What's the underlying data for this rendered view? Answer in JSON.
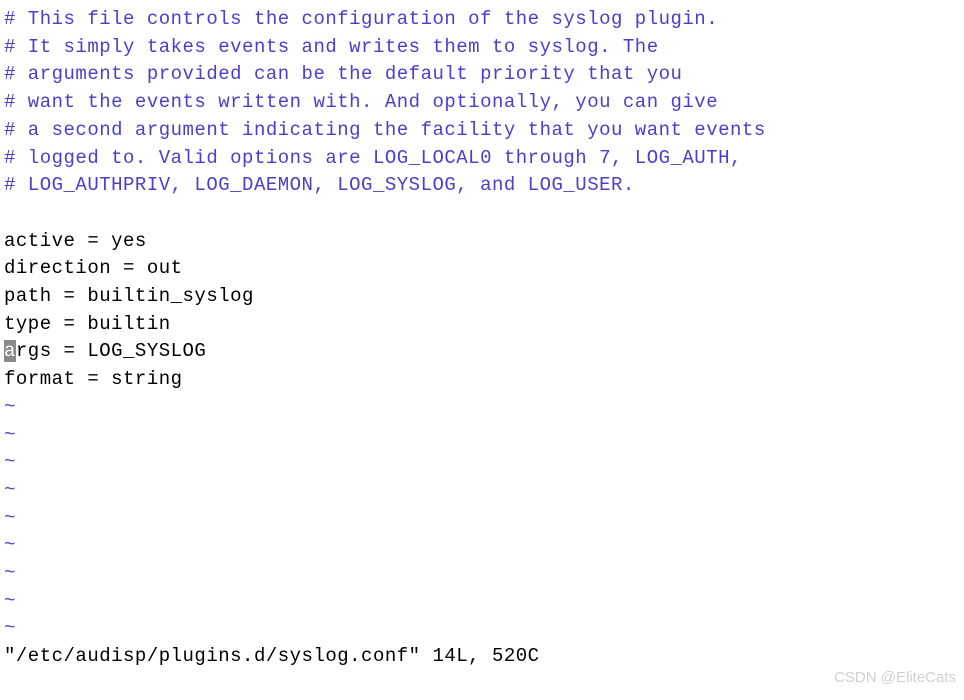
{
  "editor": {
    "comments": [
      "# This file controls the configuration of the syslog plugin.",
      "# It simply takes events and writes them to syslog. The",
      "# arguments provided can be the default priority that you",
      "# want the events written with. And optionally, you can give",
      "# a second argument indicating the facility that you want events",
      "# logged to. Valid options are LOG_LOCAL0 through 7, LOG_AUTH,",
      "# LOG_AUTHPRIV, LOG_DAEMON, LOG_SYSLOG, and LOG_USER."
    ],
    "config": {
      "active": "active = yes",
      "direction": "direction = out",
      "path": "path = builtin_syslog",
      "type": "type = builtin",
      "args_cursor_char": "a",
      "args_rest": "rgs = LOG_SYSLOG",
      "format": "format = string"
    },
    "tilde": "~",
    "status_line": "\"/etc/audisp/plugins.d/syslog.conf\" 14L, 520C"
  },
  "watermark": "CSDN @EliteCats"
}
